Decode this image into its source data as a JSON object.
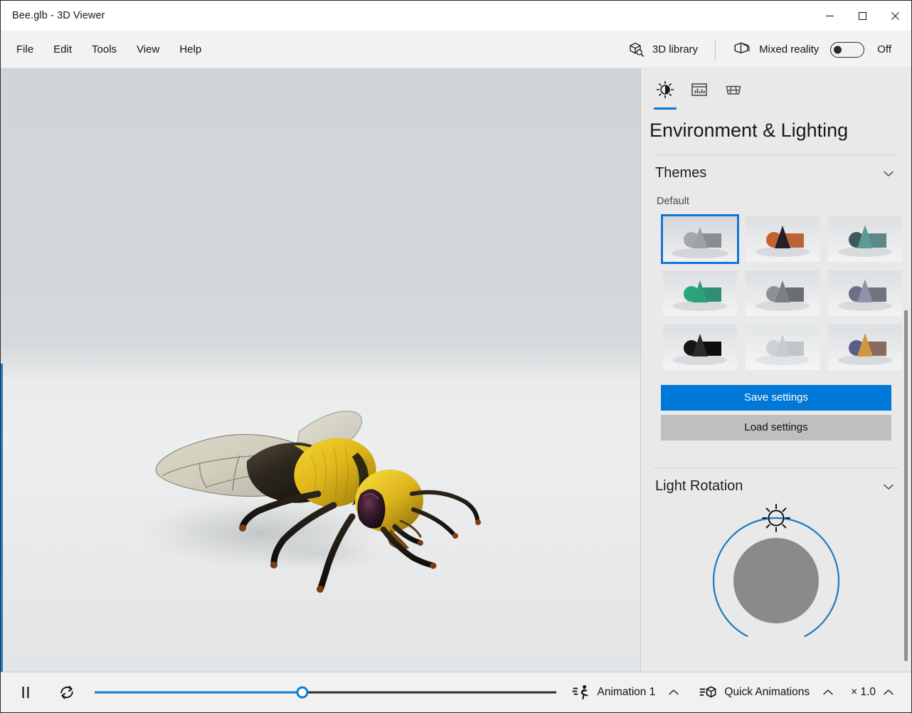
{
  "window": {
    "title": "Bee.glb - 3D Viewer",
    "controls": {
      "minimize": "Minimize",
      "maximize": "Maximize",
      "close": "Close"
    }
  },
  "menu": {
    "items": [
      {
        "label": "File"
      },
      {
        "label": "Edit"
      },
      {
        "label": "Tools"
      },
      {
        "label": "View"
      },
      {
        "label": "Help"
      }
    ]
  },
  "toolbar": {
    "library_label": "3D library",
    "library_icon": "cube-search-icon",
    "mixed_reality_label": "Mixed reality",
    "mixed_reality_icon": "mixed-reality-icon",
    "mixed_reality_state": "Off",
    "mixed_reality_on": false
  },
  "viewport": {
    "model_name": "Bee.glb",
    "model_icon": "bee-3d-model"
  },
  "panel": {
    "title": "Environment & Lighting",
    "tabs": [
      {
        "id": "lighting",
        "icon": "brightness-sun-icon",
        "active": true
      },
      {
        "id": "statistics",
        "icon": "statistics-chart-icon",
        "active": false
      },
      {
        "id": "grid",
        "icon": "grid-table-icon",
        "active": false
      }
    ],
    "themes_section": {
      "heading": "Themes",
      "collapse_icon": "chevron-down-icon",
      "group_label": "Default",
      "thumbnails": [
        {
          "name": "theme-default-gray",
          "selected": true,
          "sphere": "#a5a8ab",
          "cone": "#9fa2a5",
          "cube": "#8b8e91",
          "bg_top": "#d4d7da",
          "bg_bottom": "#f0f1f2"
        },
        {
          "name": "theme-sunset-orange",
          "selected": false,
          "sphere": "#c4622f",
          "cone": "#241f2c",
          "cube": "#bf6336",
          "bg_top": "#dcdfe2",
          "bg_bottom": "#f2f3f4"
        },
        {
          "name": "theme-teal-studio",
          "selected": false,
          "sphere": "#3e5a5b",
          "cone": "#5e9b95",
          "cube": "#5b8a85",
          "bg_top": "#dcdfe2",
          "bg_bottom": "#f2f3f4"
        },
        {
          "name": "theme-emerald",
          "selected": false,
          "sphere": "#2aa578",
          "cone": "#2f9f79",
          "cube": "#2f8f72",
          "bg_top": "#dcdfe2",
          "bg_bottom": "#f2f3f4"
        },
        {
          "name": "theme-dim-gray",
          "selected": false,
          "sphere": "#8e9195",
          "cone": "#7b7e82",
          "cube": "#6b6e72",
          "bg_top": "#dcdfe2",
          "bg_bottom": "#f2f3f4"
        },
        {
          "name": "theme-lavender",
          "selected": false,
          "sphere": "#6e7184",
          "cone": "#8f92ad",
          "cube": "#72757f",
          "bg_top": "#dcdfe2",
          "bg_bottom": "#f2f3f4"
        },
        {
          "name": "theme-night-black",
          "selected": false,
          "sphere": "#151515",
          "cone": "#2a2a2a",
          "cube": "#0c0c0c",
          "bg_top": "#dcdfe2",
          "bg_bottom": "#f2f3f4"
        },
        {
          "name": "theme-soft-white",
          "selected": false,
          "sphere": "#cfd2d4",
          "cone": "#c8cbcd",
          "cube": "#c2c5c7",
          "bg_top": "#e2e5e7",
          "bg_bottom": "#f4f5f6"
        },
        {
          "name": "theme-warm-amber",
          "selected": false,
          "sphere": "#5b5d86",
          "cone": "#cf9a3f",
          "cube": "#8a6a5b",
          "bg_top": "#dcdfe2",
          "bg_bottom": "#f2f3f4"
        }
      ],
      "save_label": "Save settings",
      "load_label": "Load settings"
    },
    "light_rotation_section": {
      "heading": "Light Rotation",
      "collapse_icon": "chevron-down-icon",
      "dial_icon": "sun-icon",
      "dial_angle_deg": 0
    },
    "scrollbar": {
      "name": "panel-scrollbar"
    }
  },
  "animation_bar": {
    "play_pause_icon": "pause-icon",
    "loop_icon": "loop-repeat-icon",
    "scrub_percent": 45,
    "animation_icon": "animation-runner-icon",
    "animation_label": "Animation 1",
    "animation_chevron": "chevron-up-icon",
    "quick_animations_icon": "quick-animations-cube-icon",
    "quick_animations_label": "Quick Animations",
    "quick_animations_chevron": "chevron-up-icon",
    "speed_label": "× 1.0",
    "speed_chevron": "chevron-up-icon"
  },
  "colors": {
    "accent": "#0078d7",
    "accent_tab": "#1177d1",
    "panel_bg": "#e9e9e9",
    "menubar_bg": "#f2f2f2",
    "secondary_button": "#bfbfbf"
  }
}
